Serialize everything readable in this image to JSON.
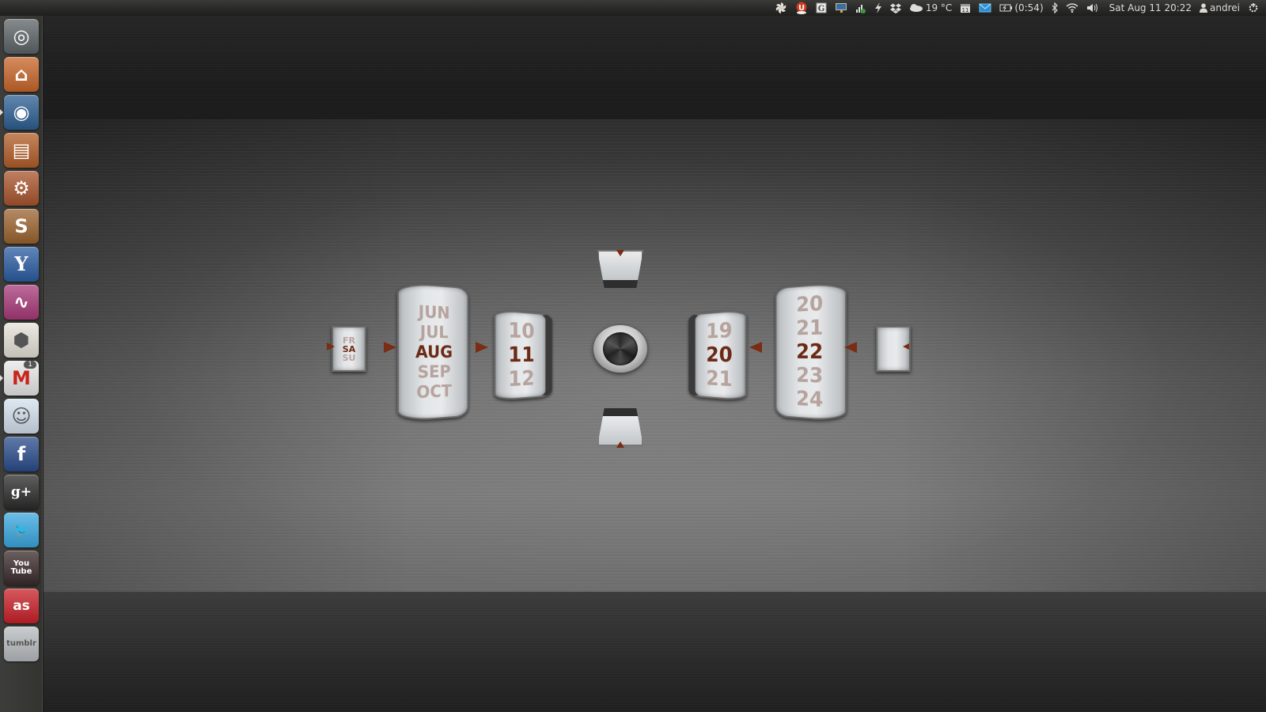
{
  "top_panel": {
    "indicators": [
      {
        "name": "shutter-icon",
        "label": ""
      },
      {
        "name": "ubuntuone-icon",
        "label": ""
      },
      {
        "name": "gmail-g-icon",
        "label": ""
      },
      {
        "name": "monitor-icon",
        "label": ""
      },
      {
        "name": "network-signal-icon",
        "label": ""
      },
      {
        "name": "power-bolt-icon",
        "label": ""
      },
      {
        "name": "dropbox-icon",
        "label": ""
      },
      {
        "name": "weather-icon",
        "label": "19 °C"
      },
      {
        "name": "calendar-icon",
        "label": "11"
      },
      {
        "name": "mail-icon",
        "label": ""
      },
      {
        "name": "battery-icon",
        "label": "(0:54)"
      },
      {
        "name": "bluetooth-icon",
        "label": ""
      },
      {
        "name": "wifi-icon",
        "label": ""
      },
      {
        "name": "volume-icon",
        "label": ""
      }
    ],
    "clock": "Sat Aug 11 20:22",
    "user": "andrei"
  },
  "launcher": {
    "items": [
      {
        "name": "dash-home",
        "glyph": "◎",
        "running": false,
        "bg": "#5e6467"
      },
      {
        "name": "home-folder",
        "glyph": "⌂",
        "running": false,
        "bg": "#c9662a"
      },
      {
        "name": "firefox",
        "glyph": "◉",
        "running": true,
        "bg": "#2d5f93"
      },
      {
        "name": "file-archiver",
        "glyph": "▤",
        "running": false,
        "bg": "#b35e28"
      },
      {
        "name": "system-settings",
        "glyph": "⚙",
        "running": false,
        "bg": "#a9552d"
      },
      {
        "name": "sublime-text",
        "glyph": "S",
        "running": false,
        "bg": "#9d6430"
      },
      {
        "name": "y-ppa-manager",
        "glyph": "Y",
        "running": false,
        "bg": "#2c5ea3"
      },
      {
        "name": "system-monitor",
        "glyph": "∿",
        "running": false,
        "bg": "#a83a7a"
      },
      {
        "name": "pencil-app",
        "glyph": "⬢",
        "running": false,
        "bg": "#e6e2d8"
      },
      {
        "name": "gmail",
        "glyph": "M",
        "running": true,
        "bg": "#e8e8e8",
        "badge": "1"
      },
      {
        "name": "reddit",
        "glyph": "☺",
        "running": false,
        "bg": "#d4e1ef"
      },
      {
        "name": "facebook",
        "glyph": "f",
        "running": false,
        "bg": "#2b4d8c"
      },
      {
        "name": "google-plus",
        "glyph": "g+",
        "running": false,
        "bg": "#2b2b2b"
      },
      {
        "name": "twitter",
        "glyph": "🐦",
        "running": false,
        "bg": "#3aa8e0"
      },
      {
        "name": "youtube",
        "glyph": "You Tube",
        "running": false,
        "bg": "#3a2a2a"
      },
      {
        "name": "lastfm",
        "glyph": "as",
        "running": false,
        "bg": "#c92128"
      },
      {
        "name": "tumblr",
        "glyph": "tumblr",
        "running": false,
        "bg": "#b8bcc0"
      }
    ]
  },
  "widget": {
    "weekday": {
      "values": [
        "FR",
        "SA",
        "SU"
      ],
      "selected": "SA"
    },
    "month": {
      "values": [
        "JUN",
        "JUL",
        "AUG",
        "SEP",
        "OCT"
      ],
      "selected": "AUG"
    },
    "day": {
      "values": [
        "10",
        "11",
        "12"
      ],
      "selected": "11"
    },
    "hour": {
      "values": [
        "19",
        "20",
        "21"
      ],
      "selected": "20"
    },
    "minute": {
      "values": [
        "20",
        "21",
        "22",
        "23",
        "24"
      ],
      "selected": "22"
    },
    "accent_color": "#6b2a16"
  }
}
